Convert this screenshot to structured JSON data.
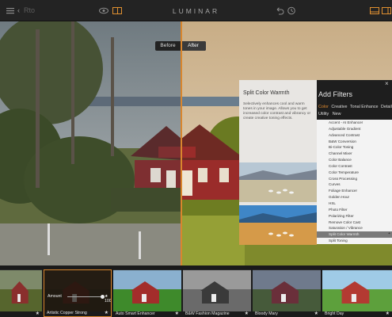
{
  "toolbar": {
    "back_label": "Rto",
    "app_title": "LUMINAR"
  },
  "compare": {
    "before_label": "Before",
    "after_label": "After"
  },
  "filter_info": {
    "title": "Split Color Warmth",
    "description": "Selectively enhances cool and warm tones in your image. Allows you to get increased color contrast and vibrancy or create creative toning effects."
  },
  "add_filters": {
    "title": "Add Filters",
    "close": "×",
    "tabs": [
      "Color",
      "Creative",
      "Tonal Enhance",
      "Detail"
    ],
    "tabs_row2": [
      "Utility",
      "New"
    ],
    "selected_tab": "Color",
    "items": [
      "Accent - AI Enhancer",
      "Adjustable Gradient",
      "Advanced Contrast",
      "B&W Conversion",
      "Bi-Color Toning",
      "Channel Mixer",
      "Color Balance",
      "Color Contrast",
      "Color Temperature",
      "Cross Processing",
      "Curves",
      "Foliage Enhancer",
      "Golden Hour",
      "HSL",
      "Photo Filter",
      "Polarizing Filter",
      "Remove Color Cast",
      "Saturation / Vibrance",
      "Split Color Warmth",
      "Split Toning"
    ],
    "selected_item": "Split Color Warmth",
    "add_symbol": "+"
  },
  "presets": {
    "amount_label": "Amount",
    "amount_value": "100",
    "amount_fraction": 1.0,
    "star": "★",
    "items": [
      {
        "label": ""
      },
      {
        "label": "Artistic Copper Strong"
      },
      {
        "label": "Auto Smart Enhancer"
      },
      {
        "label": "B&W Fashion Magazine"
      },
      {
        "label": "Bloody Mary"
      },
      {
        "label": "Bright Day"
      }
    ],
    "active_index": 1
  },
  "colors": {
    "accent": "#d9862d",
    "toolbar_bg": "#232323",
    "panel_bg": "#1e1e1e"
  },
  "icons": [
    "menu-icon",
    "eye-icon",
    "compare-icon",
    "undo-icon",
    "history-icon",
    "presets-panel-icon",
    "filters-panel-icon"
  ]
}
